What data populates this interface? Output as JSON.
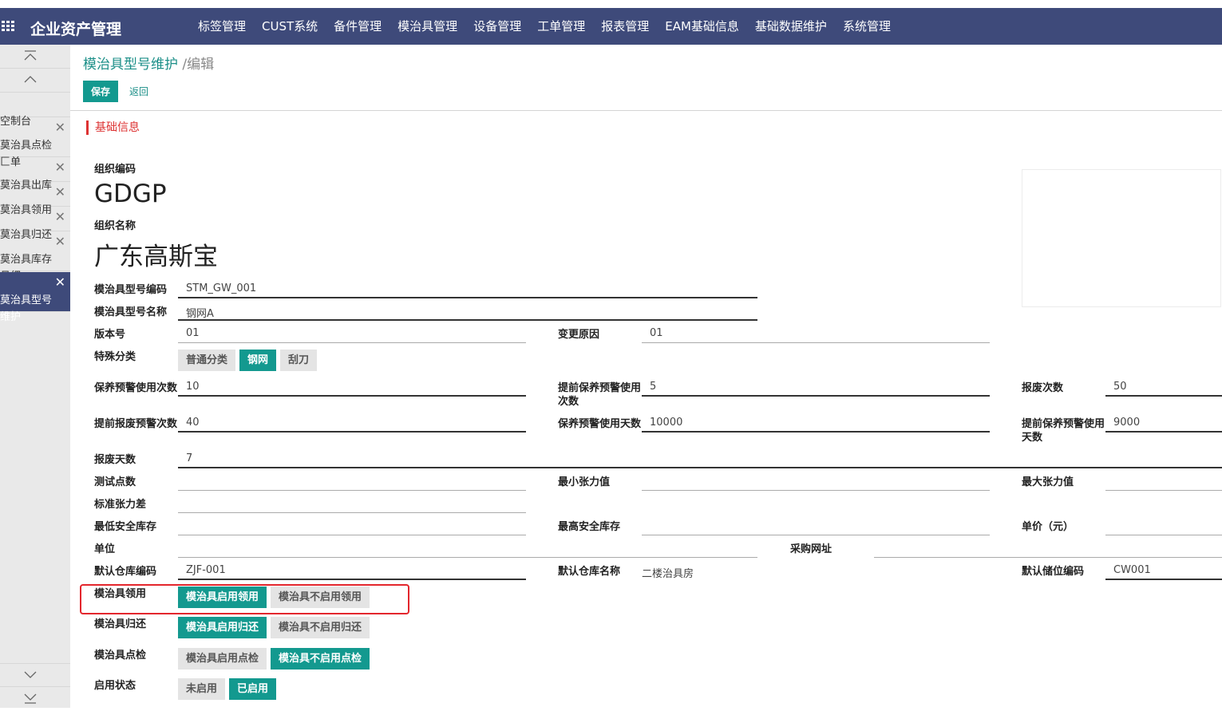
{
  "topbar": {
    "brand": "企业资产管理",
    "menu": [
      "标签管理",
      "CUST系统",
      "备件管理",
      "模治具管理",
      "设备管理",
      "工单管理",
      "报表管理",
      "EAM基础信息",
      "基础数据维护",
      "系统管理"
    ]
  },
  "sidebar": {
    "items": [
      {
        "label": "空制台",
        "closable": false
      },
      {
        "label": "莫治具点检\n匚单",
        "closable": true
      },
      {
        "label": "莫治具出库",
        "closable": true
      },
      {
        "label": "莫治具领用",
        "closable": true
      },
      {
        "label": "莫治具归还",
        "closable": true
      },
      {
        "label": "莫治具库存\n月细",
        "closable": true
      },
      {
        "label": "莫治具型号\n维护",
        "closable": true
      }
    ]
  },
  "header": {
    "breadcrumb": "模治具型号维护",
    "separator": " /",
    "mode": "编辑",
    "save_label": "保存",
    "back_label": "返回"
  },
  "section": {
    "title": "基础信息"
  },
  "org": {
    "code_label": "组织编码",
    "code": "GDGP",
    "name_label": "组织名称",
    "name": "广东高斯宝"
  },
  "form": {
    "model_code": {
      "label": "模治具型号编码",
      "value": "STM_GW_001"
    },
    "model_name": {
      "label": "模治具型号名称",
      "value": "钢网A"
    },
    "version": {
      "label": "版本号",
      "value": "01"
    },
    "change_reason": {
      "label": "变更原因",
      "value": "01"
    },
    "special_category": {
      "label": "特殊分类",
      "options": [
        "普通分类",
        "钢网",
        "刮刀"
      ],
      "selected": "钢网"
    },
    "maint_warn_count": {
      "label": "保养预警使用次数",
      "value": "10"
    },
    "adv_maint_warn_count": {
      "label": "提前保养预警使用次数",
      "value": "5"
    },
    "scrap_count": {
      "label": "报废次数",
      "value": "50"
    },
    "adv_scrap_warn_count": {
      "label": "提前报废预警次数",
      "value": "40"
    },
    "maint_warn_days": {
      "label": "保养预警使用天数",
      "value": "10000"
    },
    "adv_maint_warn_days": {
      "label": "提前保养预警使用天数",
      "value": "9000"
    },
    "scrap_days": {
      "label": "报废天数",
      "value": "7"
    },
    "test_points": {
      "label": "测试点数",
      "value": ""
    },
    "min_tension": {
      "label": "最小张力值",
      "value": ""
    },
    "max_tension": {
      "label": "最大张力值",
      "value": ""
    },
    "std_tension_diff": {
      "label": "标准张力差",
      "value": ""
    },
    "min_safety_stock": {
      "label": "最低安全库存",
      "value": ""
    },
    "max_safety_stock": {
      "label": "最高安全库存",
      "value": ""
    },
    "unit_price": {
      "label": "单价（元）",
      "value": ""
    },
    "unit": {
      "label": "单位",
      "value": ""
    },
    "purchase_url": {
      "label": "采购网址",
      "value": ""
    },
    "default_wh_code": {
      "label": "默认仓库编码",
      "value": "ZJF-001"
    },
    "default_wh_name": {
      "label": "默认仓库名称",
      "value": "二楼治具房"
    },
    "default_loc_code": {
      "label": "默认储位编码",
      "value": "CW001"
    },
    "tool_receive": {
      "label": "模治具领用",
      "options": [
        "模治具启用领用",
        "模治具不启用领用"
      ],
      "selected": "模治具启用领用"
    },
    "tool_return": {
      "label": "模治具归还",
      "options": [
        "模治具启用归还",
        "模治具不启用归还"
      ],
      "selected": "模治具启用归还"
    },
    "tool_inspect": {
      "label": "模治具点检",
      "options": [
        "模治具启用点检",
        "模治具不启用点检"
      ],
      "selected": "模治具不启用点检"
    },
    "enable_status": {
      "label": "启用状态",
      "options": [
        "未启用",
        "已启用"
      ],
      "selected": "已启用"
    }
  },
  "colors": {
    "nav": "#3e4a7a",
    "accent": "#13998f",
    "highlight": "#e3262d"
  }
}
